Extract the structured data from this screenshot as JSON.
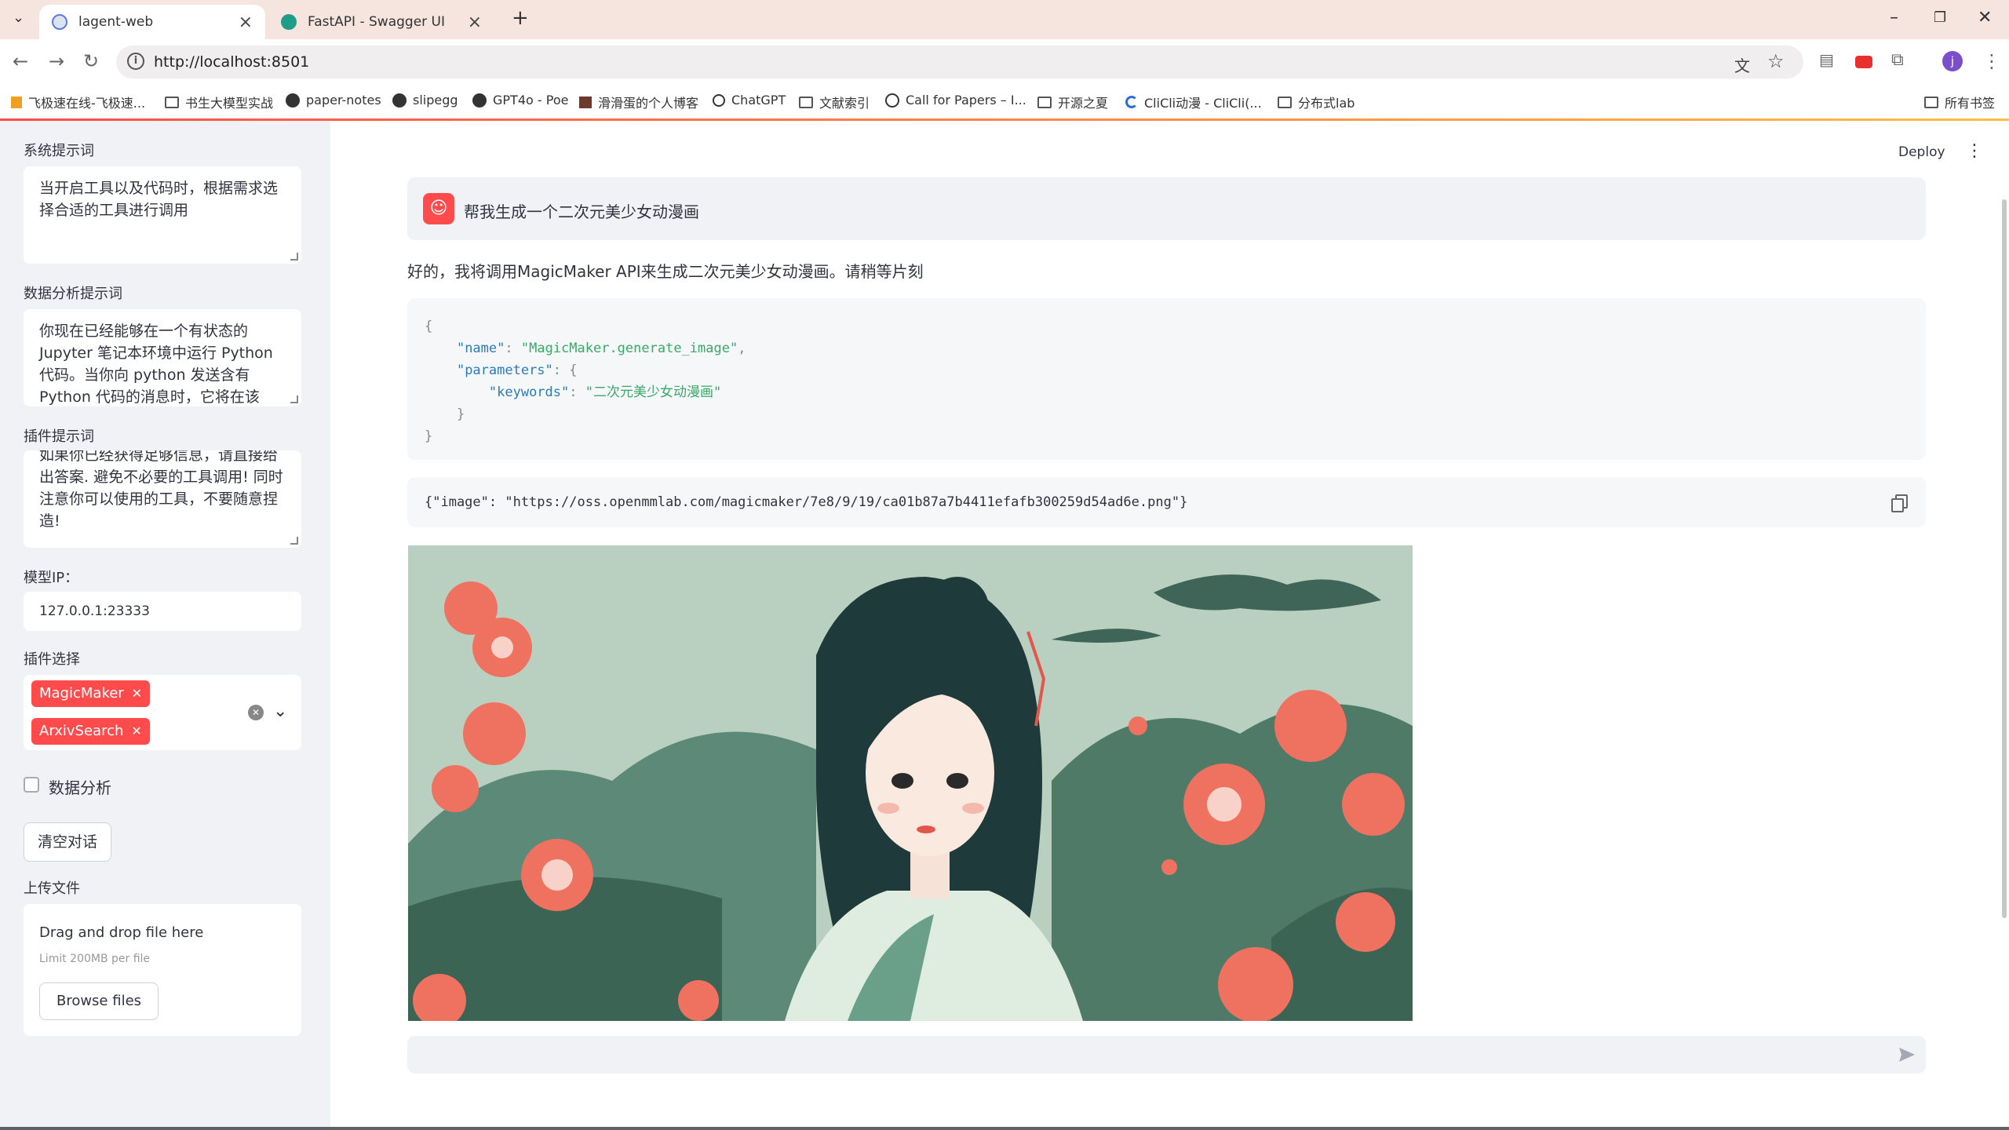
{
  "browser": {
    "tabs": [
      {
        "title": "lagent-web",
        "active": true
      },
      {
        "title": "FastAPI - Swagger UI",
        "active": false
      }
    ],
    "url": "http://localhost:8501",
    "bookmarks": [
      "飞极速在线-飞极速...",
      "书生大模型实战",
      "paper-notes",
      "slipegg",
      "GPT4o - Poe",
      "滑滑蛋的个人博客",
      "ChatGPT",
      "文献索引",
      "Call for Papers – I...",
      "开源之夏",
      "CliCli动漫 - CliCli(...",
      "分布式lab",
      "所有书签"
    ],
    "profile_initial": "j"
  },
  "sidebar": {
    "system_prompt_label": "系统提示词",
    "system_prompt_value": "当开启工具以及代码时，根据需求选择合适的工具进行调用",
    "data_prompt_label": "数据分析提示词",
    "data_prompt_value": "你现在已经能够在一个有状态的 Jupyter 笔记本环境中运行 Python 代码。当你向 python 发送含有 Python 代码的消息时，它将在该",
    "plugin_prompt_label": "插件提示词",
    "plugin_prompt_value": "如果你已经获得足够信息，请直接给出答案. 避免不必要的工具调用! 同时注意你可以使用的工具，不要随意捏造!",
    "model_ip_label": "模型IP：",
    "model_ip_value": "127.0.0.1:23333",
    "plugin_select_label": "插件选择",
    "plugins": [
      "MagicMaker",
      "ArxivSearch"
    ],
    "data_analysis_label": "数据分析",
    "clear_button": "清空对话",
    "upload_label": "上传文件",
    "dropzone_title": "Drag and drop file here",
    "dropzone_limit": "Limit 200MB per file",
    "browse_button": "Browse files"
  },
  "main": {
    "deploy": "Deploy",
    "user_message": "帮我生成一个二次元美少女动漫画",
    "assistant_reply": "好的，我将调用MagicMaker API来生成二次元美少女动漫画。请稍等片刻",
    "code": {
      "name_key": "\"name\"",
      "name_value": "\"MagicMaker.generate_image\"",
      "params_key": "\"parameters\"",
      "keywords_key": "\"keywords\"",
      "keywords_value": "\"二次元美少女动漫画\""
    },
    "result": "{\"image\": \"https://oss.openmmlab.com/magicmaker/7e8/9/19/ca01b87a7b4411efafb300259d54ad6e.png\"}"
  },
  "colors": {
    "accent": "#ff4b4b",
    "sidebar_bg": "#f0f2f6",
    "tab_strip": "#f6e4df"
  }
}
